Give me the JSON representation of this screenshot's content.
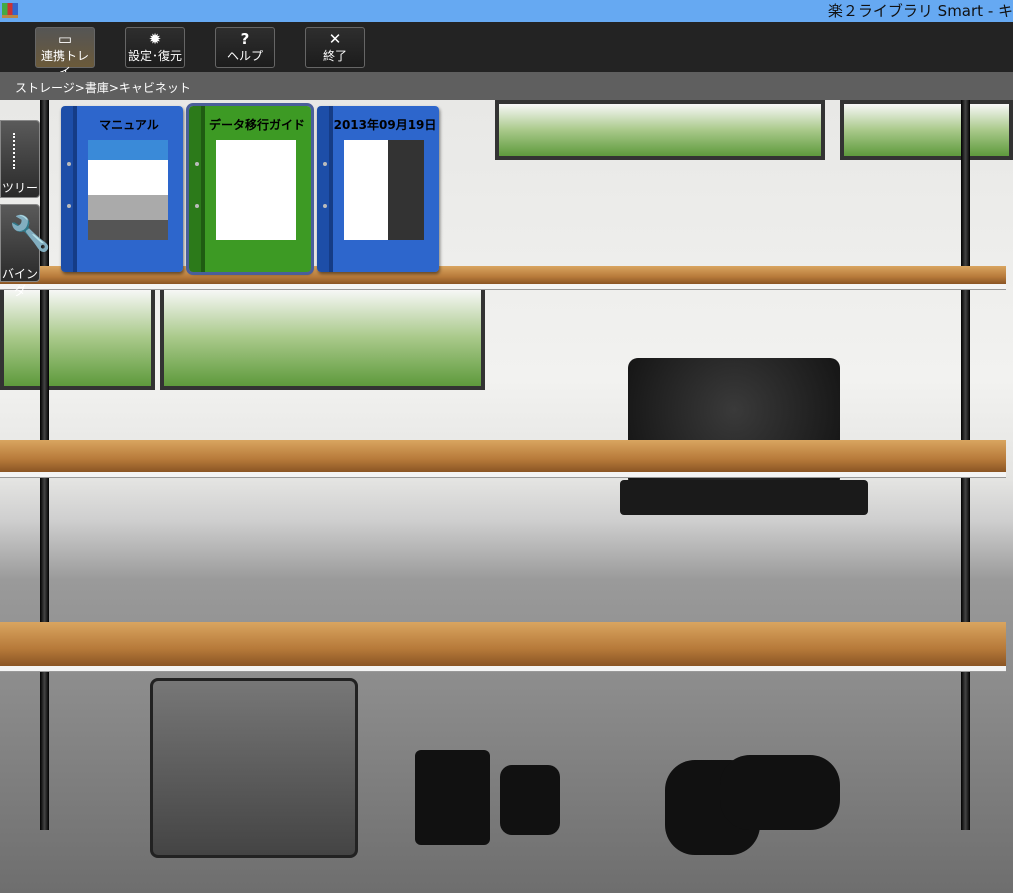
{
  "window": {
    "title": "楽２ライブラリ Smart - キ"
  },
  "toolbar": {
    "buttons": [
      {
        "label": "連携トレイ",
        "icon": "tray-icon",
        "glyph": "▭"
      },
      {
        "label": "設定･復元",
        "icon": "gear-icon",
        "glyph": "✹"
      },
      {
        "label": "ヘルプ",
        "icon": "help-icon",
        "glyph": "?"
      },
      {
        "label": "終了",
        "icon": "close-icon",
        "glyph": "✕"
      }
    ]
  },
  "breadcrumb": "ストレージ>書庫>キャビネット",
  "side_tabs": {
    "tree": "ツリー",
    "binder": "バインダ"
  },
  "binders": [
    {
      "title": "マニュアル",
      "color": "#2d66cc"
    },
    {
      "title": "データ移行ガイド",
      "color": "#3d9a24"
    },
    {
      "title": "2013年09月19日",
      "color": "#2d66cc"
    }
  ]
}
